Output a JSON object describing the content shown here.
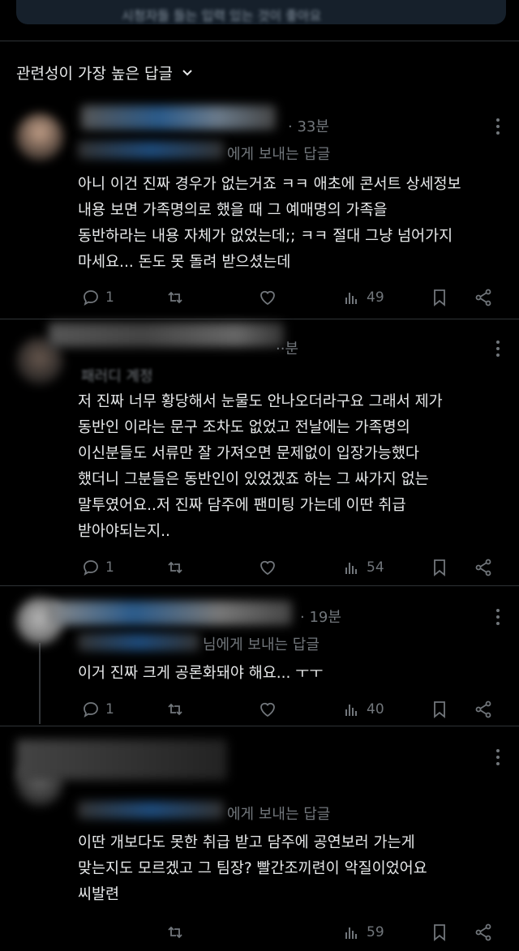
{
  "top_card": {
    "text": "시청자들 들는 입력 있는 것이 좋아요"
  },
  "sort": {
    "label": "관련성이 가장 높은 답글"
  },
  "replies": [
    {
      "time": "· 33분",
      "replying": "에게 보내는 답글",
      "text": "아니 이건 진짜 경우가 없는거죠 ㅋㅋ 애초에 콘서트 상세정보\n내용 보면 가족명의로 했을 때 그 예매명의 가족을\n동반하라는 내용 자체가 없었는데;; ㅋㅋ 절대 그냥 넘어가지\n마세요... 돈도 못 돌려 받으셨는데",
      "replies": "1",
      "views": "49"
    },
    {
      "time": "··분",
      "replying": "패러디 계정",
      "text": "저 진짜 너무 황당해서 눈물도 안나오더라구요 그래서 제가\n동반인 이라는 문구 조차도 없었고 전날에는 가족명의\n이신분들도 서류만 잘 가져오면 문제없이 입장가능했다\n했더니 그분들은 동반인이 있었겠죠 하는 그 싸가지 없는\n말투였어요..저 진짜 담주에 팬미팅 가는데 이딴 취급\n받아야되는지..",
      "replies": "1",
      "views": "54"
    },
    {
      "time": "· 19분",
      "replying": "님에게 보내는 답글",
      "text": "이거 진짜 크게 공론화돼야 해요... ㅜㅜ",
      "replies": "1",
      "views": "40"
    },
    {
      "time": "",
      "replying": "에게 보내는 답글",
      "text": "이딴 개보다도 못한 취급 받고 담주에 공연보러 가는게\n맞는지도 모르겠고 그 팀장? 빨간조끼련이 악질이었어요\n씨발련",
      "replies": "",
      "views": "59"
    }
  ],
  "colors": {
    "background": "#000000",
    "text": "#e7e9ea",
    "muted": "#71767b",
    "card": "#16202b"
  },
  "icons": [
    "chevron-down-icon",
    "more-icon",
    "reply-icon",
    "retweet-icon",
    "like-icon",
    "views-icon",
    "bookmark-icon",
    "share-icon"
  ]
}
